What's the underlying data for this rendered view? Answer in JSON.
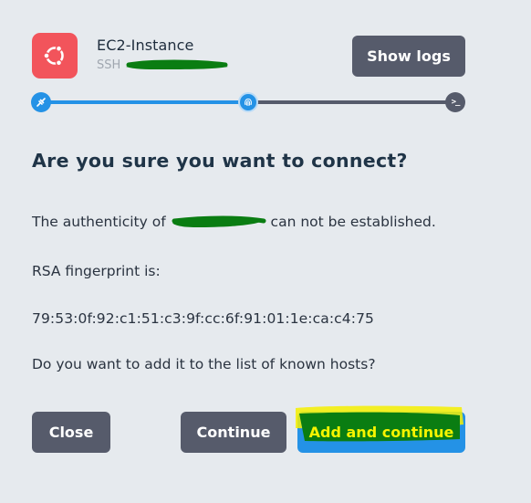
{
  "header": {
    "app_icon": "ubuntu-logo-icon",
    "host_name": "EC2-Instance",
    "connection_type": "SSH",
    "show_logs_label": "Show logs"
  },
  "progress": {
    "steps": [
      {
        "icon": "plug-icon",
        "state": "done"
      },
      {
        "icon": "fingerprint-icon",
        "state": "current"
      },
      {
        "icon": "terminal-icon",
        "state": "pending",
        "glyph": ">_"
      }
    ]
  },
  "dialog": {
    "title": "Are you sure you want to connect?",
    "authenticity_prefix": "The authenticity of",
    "authenticity_suffix": "can not be established.",
    "fingerprint_label": "RSA fingerprint is:",
    "fingerprint_value": "79:53:0f:92:c1:51:c3:9f:cc:6f:91:01:1e:ca:c4:75",
    "question": "Do you want to add it to the list of known hosts?"
  },
  "buttons": {
    "close": "Close",
    "continue": "Continue",
    "add_and_continue": "Add and continue"
  },
  "colors": {
    "background": "#e6eaee",
    "accent_blue": "#2492e6",
    "button_dark": "#565b6b",
    "app_icon_red": "#f2545b",
    "redaction_green": "#0a7d12",
    "highlight_yellow": "#f6f400"
  }
}
